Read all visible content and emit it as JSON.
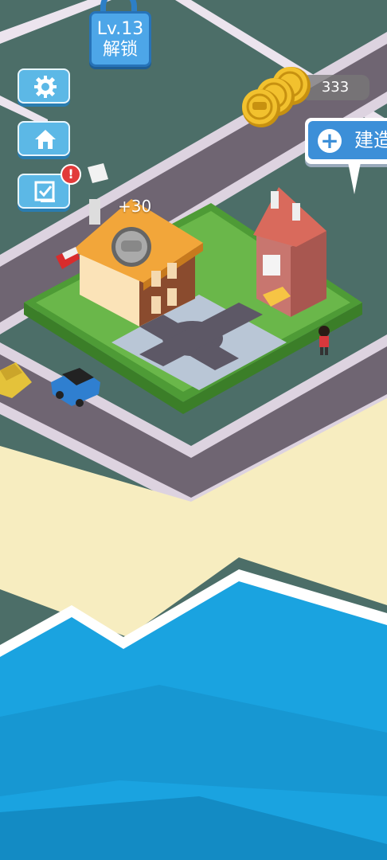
{
  "level_badge": {
    "level": "Lv.13",
    "action": "解锁"
  },
  "sidebar": {
    "items": [
      {
        "name": "settings",
        "icon": "gear-icon"
      },
      {
        "name": "home",
        "icon": "home-icon"
      },
      {
        "name": "tasks",
        "icon": "checklist-icon",
        "alert": "!"
      }
    ]
  },
  "coins": {
    "amount": "333",
    "icon": "coin-stack-icon"
  },
  "build_button": {
    "icon": "plus-icon",
    "label": "建造"
  },
  "income_popup": {
    "text": "+30"
  },
  "colors": {
    "road": "#6f6572",
    "grass": "#6ab74a",
    "hedge": "#4e9b36",
    "beach": "#f7edc0",
    "ocean": "#1aa3e0",
    "ground": "#4c6e68",
    "ui_blue": "#4da6e8"
  }
}
